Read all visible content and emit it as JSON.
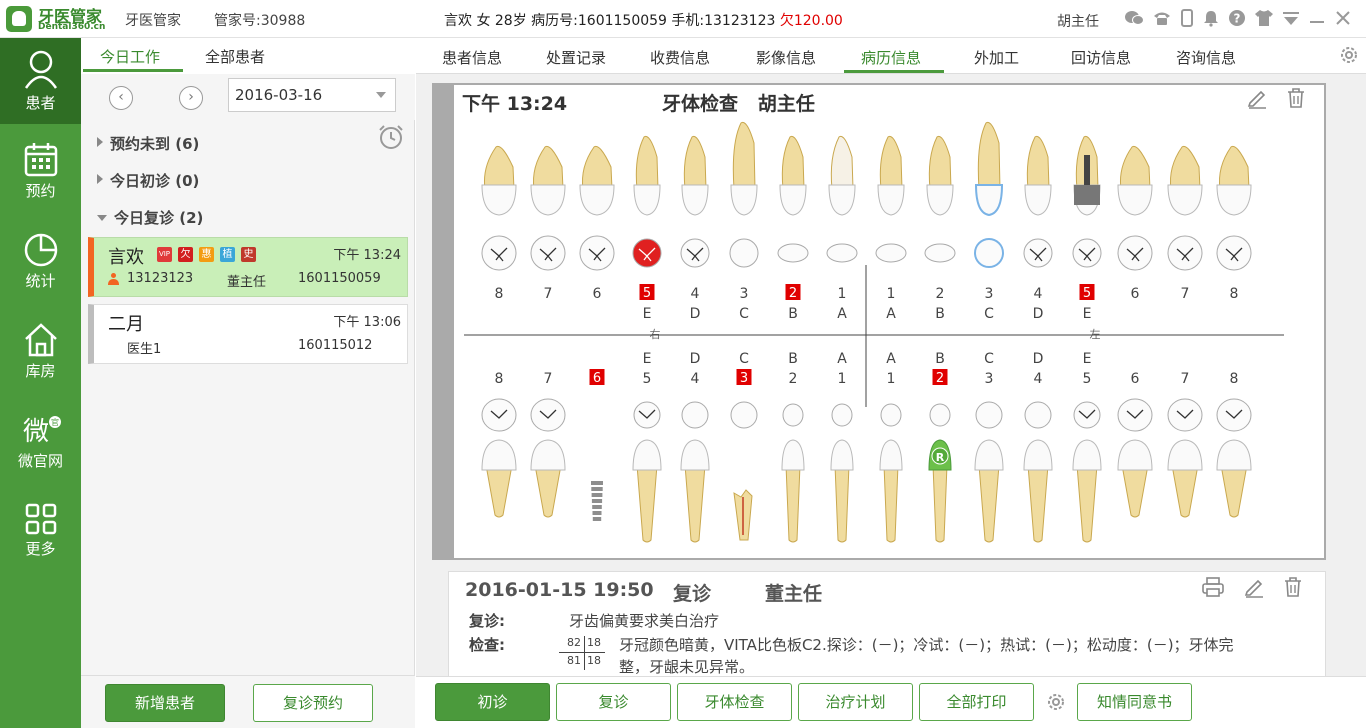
{
  "app": {
    "logo_title": "牙医管家",
    "logo_domain": "Dental360.cn",
    "name": "牙医管家",
    "account": "管家号:30988",
    "user": "胡主任"
  },
  "patient_header": {
    "info": "言欢 女 28岁  病历号:1601150059  手机:13123123",
    "owed": "欠120.00"
  },
  "leftnav": {
    "items": [
      {
        "label": "患者",
        "icon": "person-icon"
      },
      {
        "label": "预约",
        "icon": "calendar-icon"
      },
      {
        "label": "统计",
        "icon": "pie-chart-icon"
      },
      {
        "label": "库房",
        "icon": "house-icon"
      },
      {
        "label": "微官网",
        "icon": "wechat-icon"
      },
      {
        "label": "更多",
        "icon": "grid-icon"
      }
    ]
  },
  "leftpanel": {
    "tabs": [
      "今日工作",
      "全部患者"
    ],
    "date": "2016-03-16",
    "groups": [
      {
        "label": "预约未到 (6)"
      },
      {
        "label": "今日初诊 (0)"
      },
      {
        "label": "今日复诊 (2)"
      }
    ],
    "patients": [
      {
        "name": "言欢",
        "time": "下午 13:24",
        "phone": "13123123",
        "doctor": "董主任",
        "record": "1601150059",
        "badges": [
          {
            "text": "VIP",
            "color": "#e03a3a"
          },
          {
            "text": "欠",
            "color": "#d21f1f"
          },
          {
            "text": "惠",
            "color": "#f39c12"
          },
          {
            "text": "植",
            "color": "#3aa6d8"
          },
          {
            "text": "史",
            "color": "#c0392b"
          }
        ]
      },
      {
        "name": "二月",
        "time": "下午 13:06",
        "doctor": "医生1",
        "record": "160115012"
      }
    ],
    "buttons": {
      "new_patient": "新增患者",
      "revisit_appt": "复诊预约"
    }
  },
  "main": {
    "tabs": [
      "患者信息",
      "处置记录",
      "收费信息",
      "影像信息",
      "病历信息",
      "外加工",
      "回访信息",
      "咨询信息"
    ],
    "active_tab": "病历信息",
    "chart_card": {
      "time": "下午 13:24",
      "title": "牙体检查   胡主任",
      "upper_numbers": [
        "8",
        "7",
        "6",
        "5",
        "4",
        "3",
        "2",
        "1",
        "1",
        "2",
        "3",
        "4",
        "5",
        "6",
        "7",
        "8"
      ],
      "upper_letters": [
        "E",
        "D",
        "C",
        "B",
        "A",
        "A",
        "B",
        "C",
        "D",
        "E"
      ],
      "lower_letters": [
        "E",
        "D",
        "C",
        "B",
        "A",
        "A",
        "B",
        "C",
        "D",
        "E"
      ],
      "lower_numbers": [
        "8",
        "7",
        "6",
        "5",
        "4",
        "3",
        "2",
        "1",
        "1",
        "2",
        "3",
        "4",
        "5",
        "6",
        "7",
        "8"
      ],
      "right_label": "右",
      "left_label": "左",
      "tooth_marker": "R"
    },
    "record": {
      "datetime": "2016-01-15 19:50",
      "type": "复诊",
      "doctor": "董主任",
      "complaint_label": "复诊:",
      "complaint": "牙齿偏黄要求美白治疗",
      "exam_label": "检查:",
      "exam_teeth_ul": "82",
      "exam_teeth_ur": "18",
      "exam_teeth_ll": "81",
      "exam_teeth_lr": "18",
      "exam_line1": "牙冠颜色暗黄，VITA比色板C2.探诊：(－)；冷试：(－)；热试：(－)；松动度：(－)；牙体完",
      "exam_line2": "整，牙龈未见异常。"
    },
    "buttons": [
      "初诊",
      "复诊",
      "牙体检查",
      "治疗计划",
      "全部打印",
      "知情同意书"
    ]
  },
  "colors": {
    "brand": "#4b9a3c",
    "alert": "#e00000",
    "selected_row": "#c9efb8"
  }
}
